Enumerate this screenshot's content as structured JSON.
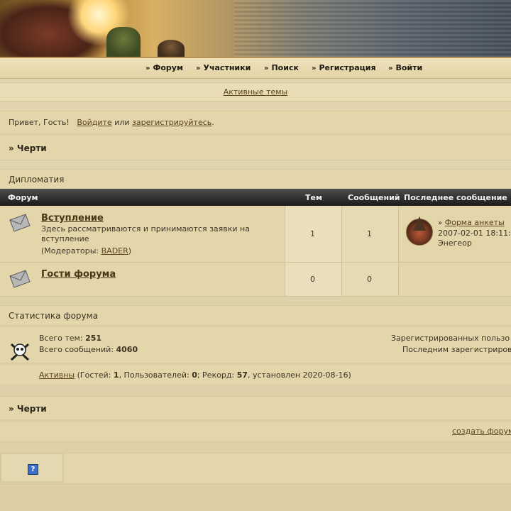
{
  "nav": {
    "items": [
      {
        "label": "Форум",
        "icon": "double-chevron-right-icon"
      },
      {
        "label": "Участники",
        "icon": "double-chevron-right-icon"
      },
      {
        "label": "Поиск",
        "icon": "double-chevron-right-icon"
      },
      {
        "label": "Регистрация",
        "icon": "double-chevron-right-icon"
      },
      {
        "label": "Войти",
        "icon": "double-chevron-right-icon"
      }
    ]
  },
  "active_topics": "Активные темы",
  "greeting": {
    "prefix": "Привет, Гость!",
    "login": "Войдите",
    "or": "или",
    "register": "зарегистрируйтесь",
    "suffix": "."
  },
  "breadcrumb": "» Черти",
  "category": {
    "title": "Дипломатия",
    "columns": {
      "forum": "Форум",
      "topics": "Тем",
      "posts": "Сообщений",
      "last": "Последнее сообщение"
    },
    "forums": [
      {
        "title": "Вступление",
        "description": "Здесь рассматриваются и принимаются заявки на вступление",
        "moderators_label": "(Модераторы:",
        "moderator": "BADER",
        "moderators_close": ")",
        "topics": "1",
        "posts": "1",
        "last_post": {
          "title": "Форма анкеты",
          "date": "2007-02-01 18:11:",
          "author": "Энегеор"
        }
      },
      {
        "title": "Гости форума",
        "topics": "0",
        "posts": "0"
      }
    ]
  },
  "stats": {
    "title": "Статистика форума",
    "total_topics_label": "Всего тем:",
    "total_topics": "251",
    "total_posts_label": "Всего сообщений:",
    "total_posts": "4060",
    "registered_label": "Зарегистрированных пользо",
    "last_registered_label": "Последним зарегистриров",
    "active_link": "Активны",
    "active_open": "(Гостей:",
    "guests": "1",
    "users_label": ", Пользователей:",
    "users": "0",
    "record_label": "; Рекорд:",
    "record": "57",
    "record_date": ", установлен 2020-08-16)"
  },
  "breadcrumb_bottom": "» Черти",
  "create_forum_link": "создать форум",
  "help_icon": "?",
  "colors": {
    "link": "#5b4219",
    "header_bg": "#2c2c2c",
    "panel_bg": "#e3d6ab"
  }
}
